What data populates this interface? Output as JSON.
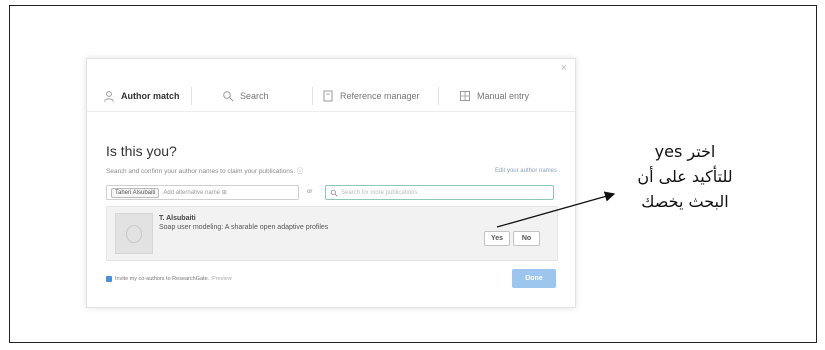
{
  "dialog": {
    "close_glyph": "×",
    "tabs": [
      {
        "label": "Author match",
        "icon": "person-icon",
        "active": true
      },
      {
        "label": "Search",
        "icon": "search-icon",
        "active": false
      },
      {
        "label": "Reference manager",
        "icon": "document-icon",
        "active": false
      },
      {
        "label": "Manual entry",
        "icon": "grid-icon",
        "active": false
      }
    ],
    "title": "Is this you?",
    "description": "Search and confirm your author names to claim your publications. ⓘ",
    "edit_link": "Edit your author names",
    "name_chip": "Taheri Alsubaiti",
    "add_name_placeholder": "Add alternative name ⊞",
    "or_label": "or",
    "search_placeholder": "Search for more publications",
    "publication": {
      "author": "T. Alsubaiti",
      "title": "Soap user modeling: A sharable open adaptive profiles",
      "yes_label": "Yes",
      "no_label": "No"
    },
    "invite_text": "Invite my co-authors to ResearchGate.",
    "invite_preview": "Preview",
    "done_label": "Done"
  },
  "annotation": {
    "line1": "اختر yes",
    "line2": "للتأكيد على أن",
    "line3": "البحث يخصك"
  },
  "colors": {
    "done_button": "#9cc6ee",
    "search_border": "#8fc9b3",
    "checkbox": "#4a90d9"
  }
}
